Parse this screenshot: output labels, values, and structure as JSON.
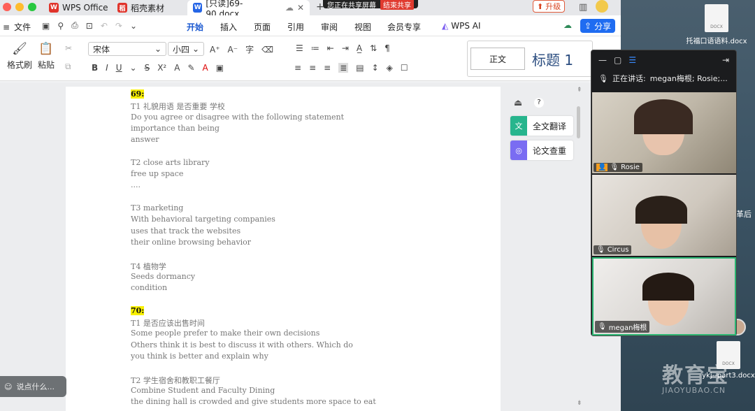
{
  "tabs": [
    {
      "label": "WPS Office",
      "color": "#e0342b"
    },
    {
      "label": "稻壳素材",
      "color": "#e0342b"
    },
    {
      "label": "[只读]69-90.docx",
      "color": "#2565e6"
    }
  ],
  "share_banner": {
    "text": "您正在共享屏幕",
    "stop": "结束共享"
  },
  "upgrade_label": "升级",
  "menu": {
    "file": "文件",
    "items": [
      "开始",
      "插入",
      "页面",
      "引用",
      "审阅",
      "视图",
      "会员专享",
      "WPS AI"
    ],
    "active": "开始",
    "share": "分享"
  },
  "ribbon": {
    "format_painter": "格式刷",
    "paste": "粘贴",
    "font_name": "宋体",
    "font_size": "小四",
    "style_normal": "正文",
    "style_heading": "标题 1"
  },
  "document": {
    "lines": [
      {
        "text": "69:",
        "highlight": true
      },
      {
        "text": "T1 礼貌用语 是否重要 学校"
      },
      {
        "text": "Do you agree or disagree with the following statement"
      },
      {
        "text": "importance than being"
      },
      {
        "text": "answer"
      },
      {
        "text": ""
      },
      {
        "text": "T2 close arts library"
      },
      {
        "text": "free up space"
      },
      {
        "text": "...."
      },
      {
        "text": ""
      },
      {
        "text": "T3 marketing"
      },
      {
        "text": "With behavioral targeting companies"
      },
      {
        "text": "uses that track the websites"
      },
      {
        "text": "their online browsing behavior"
      },
      {
        "text": ""
      },
      {
        "text": "T4 植物学"
      },
      {
        "text": "Seeds dormancy"
      },
      {
        "text": "condition"
      },
      {
        "text": ""
      },
      {
        "text": "70:",
        "highlight": true
      },
      {
        "text": "T1 是否应该出售时间"
      },
      {
        "text": "Some people prefer to make their own decisions"
      },
      {
        "text": "Others think it is best to discuss it with others. Which do"
      },
      {
        "text": "you think is better and explain why"
      },
      {
        "text": ""
      },
      {
        "text": "T2 学生宿舍和教职工餐厅"
      },
      {
        "text": "Combine Student and Faculty Dining"
      },
      {
        "text": "the dining hall is crowded and give students more space to eat"
      }
    ]
  },
  "side_tools": {
    "translate": "全文翻译",
    "check": "论文查重"
  },
  "chat_placeholder": "说点什么...",
  "meeting": {
    "speaking_label": "正在讲话:",
    "speaking_names": "megan梅根; Rosie;...",
    "participants": [
      {
        "name": "Rosie"
      },
      {
        "name": "Circus"
      },
      {
        "name": "megan梅根"
      }
    ]
  },
  "desktop": {
    "files": [
      "托福口语语料.docx",
      "ykj--part3.docx"
    ],
    "watermark": "教育宝",
    "watermark_sub": "JIAOYUBAO.CN",
    "side_text": "革后"
  }
}
